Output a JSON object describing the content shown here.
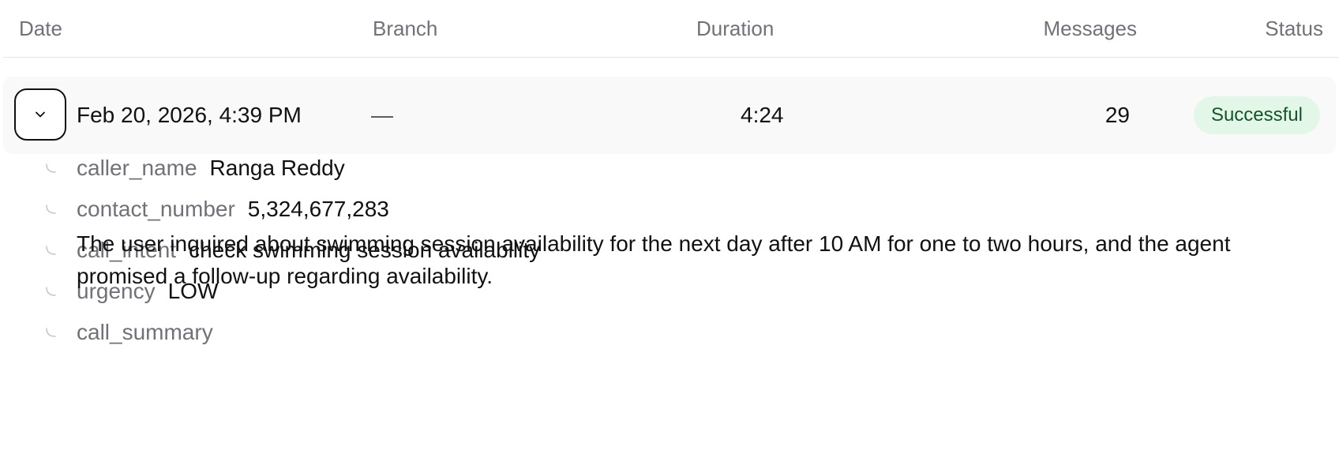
{
  "header": {
    "date": "Date",
    "branch": "Branch",
    "duration": "Duration",
    "messages": "Messages",
    "status": "Status"
  },
  "row": {
    "date": "Feb 20, 2026, 4:39 PM",
    "branch": "—",
    "duration": "4:24",
    "messages": "29",
    "status": "Successful",
    "expanded": true,
    "toggle_icon": "chevron-down-icon"
  },
  "details": [
    {
      "key": "caller_name",
      "value": "Ranga Reddy"
    },
    {
      "key": "contact_number",
      "value": "5,324,677,283"
    },
    {
      "key": "call_intent",
      "value": "check swimming session availability"
    },
    {
      "key": "urgency",
      "value": "LOW"
    },
    {
      "key": "call_summary",
      "value": "The user inquired about swimming session availability for the next day after 10 AM for one to two hours, and the agent promised a follow-up regarding availability."
    }
  ],
  "colors": {
    "status_bg": "#e3f7e8",
    "status_text": "#14532d",
    "muted_text": "#71717a",
    "row_bg": "#f9f9f9"
  }
}
